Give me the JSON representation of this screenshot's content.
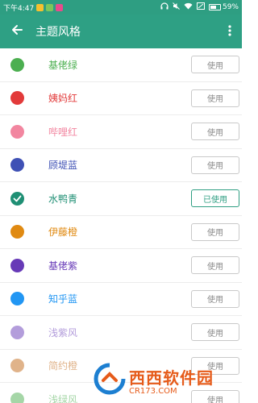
{
  "status_bar": {
    "time": "下午4:47",
    "battery": "59%",
    "app_icon_colors": [
      "#f7c02f",
      "#7dc65b",
      "#e94b8c"
    ]
  },
  "app_bar": {
    "title": "主题风格",
    "back_icon": "arrow-left-icon",
    "more_icon": "more-vert-icon"
  },
  "colors": {
    "primary": "#2e9e82",
    "check": "#1f8f74"
  },
  "themes": [
    {
      "name": "基佬绿",
      "color": "#4caf50",
      "button": "使用",
      "selected": false
    },
    {
      "name": "姨妈红",
      "color": "#e23a3a",
      "button": "使用",
      "selected": false
    },
    {
      "name": "哔哩红",
      "color": "#f286a0",
      "button": "使用",
      "selected": false
    },
    {
      "name": "顾堤蓝",
      "color": "#3f51b5",
      "button": "使用",
      "selected": false
    },
    {
      "name": "水鸭青",
      "color": "#1f8f74",
      "button": "已使用",
      "selected": true
    },
    {
      "name": "伊藤橙",
      "color": "#e08a12",
      "button": "使用",
      "selected": false
    },
    {
      "name": "基佬紫",
      "color": "#673ab7",
      "button": "使用",
      "selected": false
    },
    {
      "name": "知乎蓝",
      "color": "#2196f3",
      "button": "使用",
      "selected": false
    },
    {
      "name": "浅紫风",
      "color": "#b39ddb",
      "button": "使用",
      "selected": false
    },
    {
      "name": "简约橙",
      "color": "#e0b38a",
      "button": "使用",
      "selected": false
    },
    {
      "name": "浅绿风",
      "color": "#a5d6a7",
      "button": "使用",
      "selected": false
    }
  ],
  "watermark": {
    "title": "西西软件园",
    "url": "CR173.COM"
  }
}
